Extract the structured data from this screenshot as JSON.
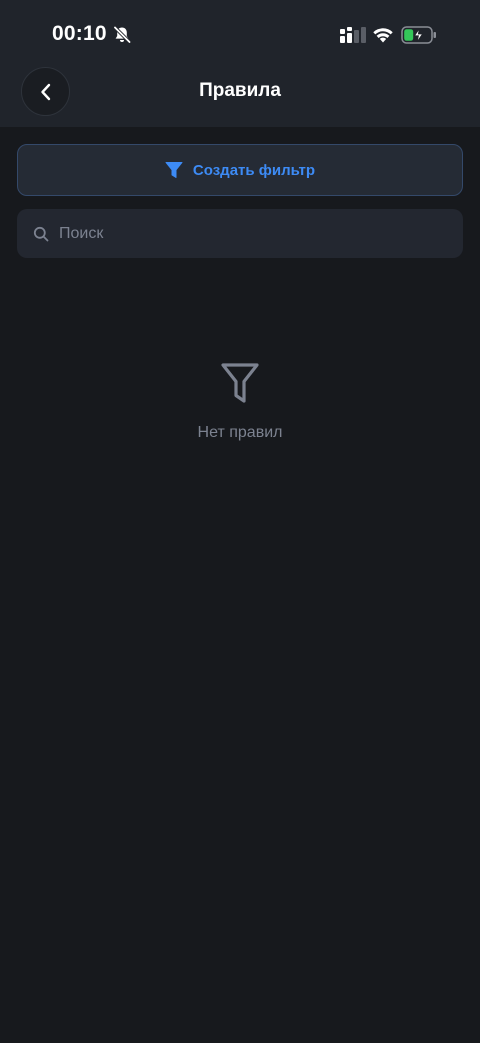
{
  "status_bar": {
    "time": "00:10",
    "icons": [
      "bell-off-icon",
      "cellular-signal-icon",
      "wifi-icon",
      "battery-charging-icon"
    ]
  },
  "nav": {
    "title": "Правила",
    "back_icon": "chevron-left-icon"
  },
  "create_filter": {
    "label": "Создать фильтр",
    "icon": "filter-icon"
  },
  "search": {
    "placeholder": "Поиск",
    "value": "",
    "icon": "search-icon"
  },
  "empty_state": {
    "text": "Нет правил",
    "icon": "filter-outline-icon"
  },
  "colors": {
    "background": "#17191d",
    "header": "#20242b",
    "accent": "#3d8bf5",
    "muted": "#7c8290",
    "battery_green": "#34c759"
  }
}
